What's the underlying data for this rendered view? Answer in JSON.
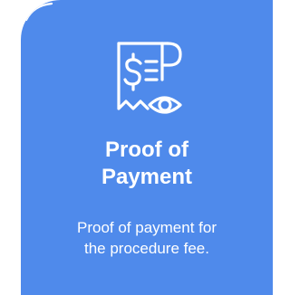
{
  "card": {
    "icon": "receipt-with-dollar-and-eye-icon",
    "title_line1": "Proof of",
    "title_line2": "Payment",
    "description_line1": "Proof of payment for",
    "description_line2": "the procedure fee.",
    "background_color": "#4f8aeb",
    "text_color": "#ffffff"
  }
}
